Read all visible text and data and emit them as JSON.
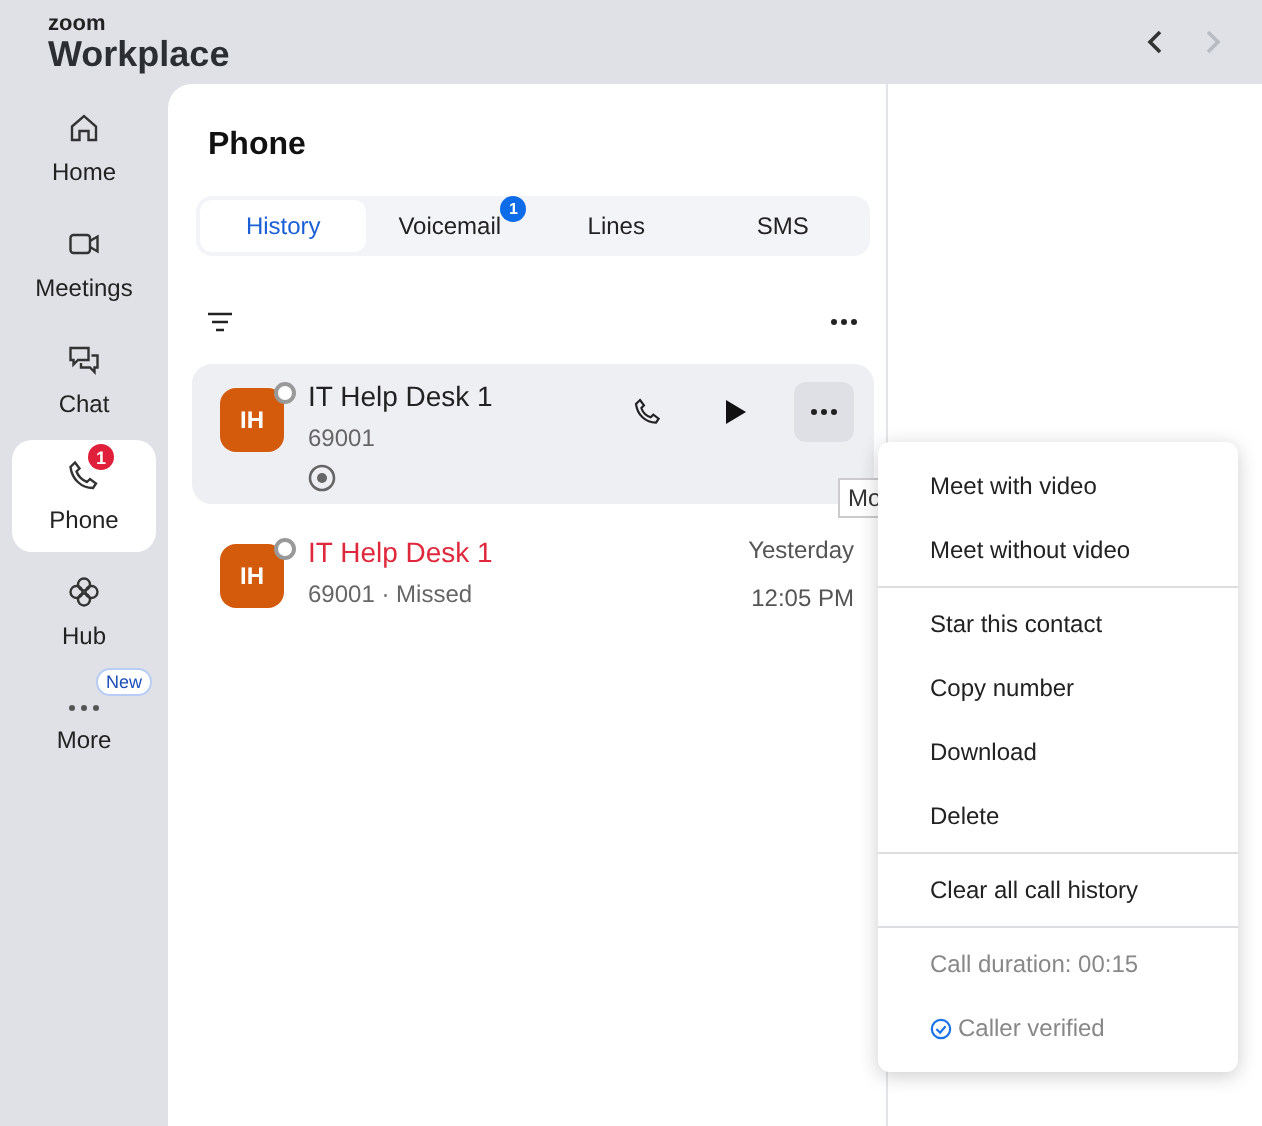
{
  "brand": {
    "small": "zoom",
    "large": "Workplace"
  },
  "history_nav": {
    "back_disabled": false,
    "forward_disabled": true
  },
  "nav": [
    {
      "label": "Home",
      "selected": false
    },
    {
      "label": "Meetings",
      "selected": false
    },
    {
      "label": "Chat",
      "selected": false
    },
    {
      "label": "Phone",
      "selected": true,
      "badge": "1"
    },
    {
      "label": "Hub",
      "selected": false
    },
    {
      "label": "More",
      "selected": false,
      "tag": "New"
    }
  ],
  "title": "Phone",
  "tabs": [
    {
      "label": "History",
      "selected": true
    },
    {
      "label": "Voicemail",
      "selected": false,
      "badge": "1"
    },
    {
      "label": "Lines",
      "selected": false
    },
    {
      "label": "SMS",
      "selected": false
    }
  ],
  "calls": [
    {
      "initials": "IH",
      "name": "IT Help Desk 1",
      "detail": "69001",
      "missed": false,
      "selected": true,
      "recorded": true
    },
    {
      "initials": "IH",
      "name": "IT Help Desk 1",
      "detail": "69001 · Missed",
      "missed": true,
      "selected": false,
      "date": "Yesterday",
      "time": "12:05 PM"
    }
  ],
  "tooltip": "Mo",
  "menu": [
    [
      {
        "kind": "action",
        "label": "Meet with video"
      },
      {
        "kind": "action",
        "label": "Meet without video"
      }
    ],
    [
      {
        "kind": "action",
        "label": "Star this contact"
      },
      {
        "kind": "action",
        "label": "Copy number"
      },
      {
        "kind": "action",
        "label": "Download"
      },
      {
        "kind": "action",
        "label": "Delete"
      }
    ],
    [
      {
        "kind": "action",
        "label": "Clear all call history"
      }
    ],
    [
      {
        "kind": "info",
        "label": "Call duration: 00:15"
      },
      {
        "kind": "verified",
        "label": "Caller verified"
      }
    ]
  ]
}
